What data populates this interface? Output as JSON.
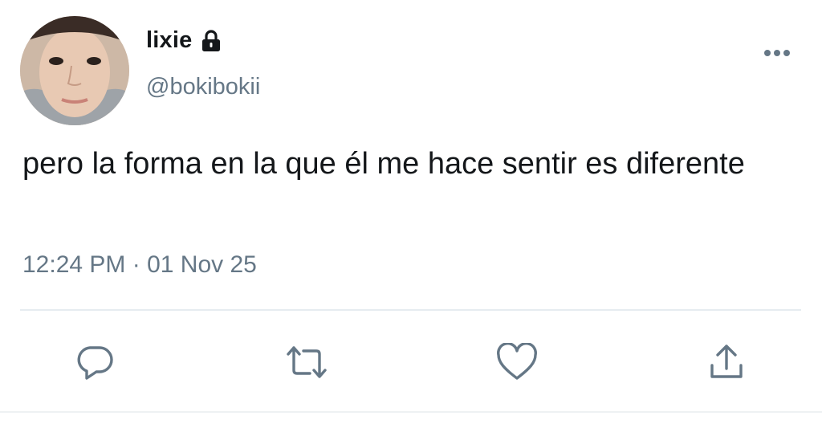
{
  "author": {
    "display_name": "lixie",
    "handle": "@bokibokii",
    "protected_icon": "lock-icon"
  },
  "tweet": {
    "text": "pero la forma en la que él me hace sentir es diferente",
    "timestamp": "12:24 PM · 01 Nov 25"
  },
  "actions": [
    {
      "icon": "reply-icon"
    },
    {
      "icon": "retweet-icon"
    },
    {
      "icon": "like-icon"
    },
    {
      "icon": "share-icon"
    }
  ],
  "menu_icon": "more-options-icon",
  "colors": {
    "text_primary": "#14171a",
    "text_secondary": "#657786",
    "divider": "#e6ecf0"
  }
}
